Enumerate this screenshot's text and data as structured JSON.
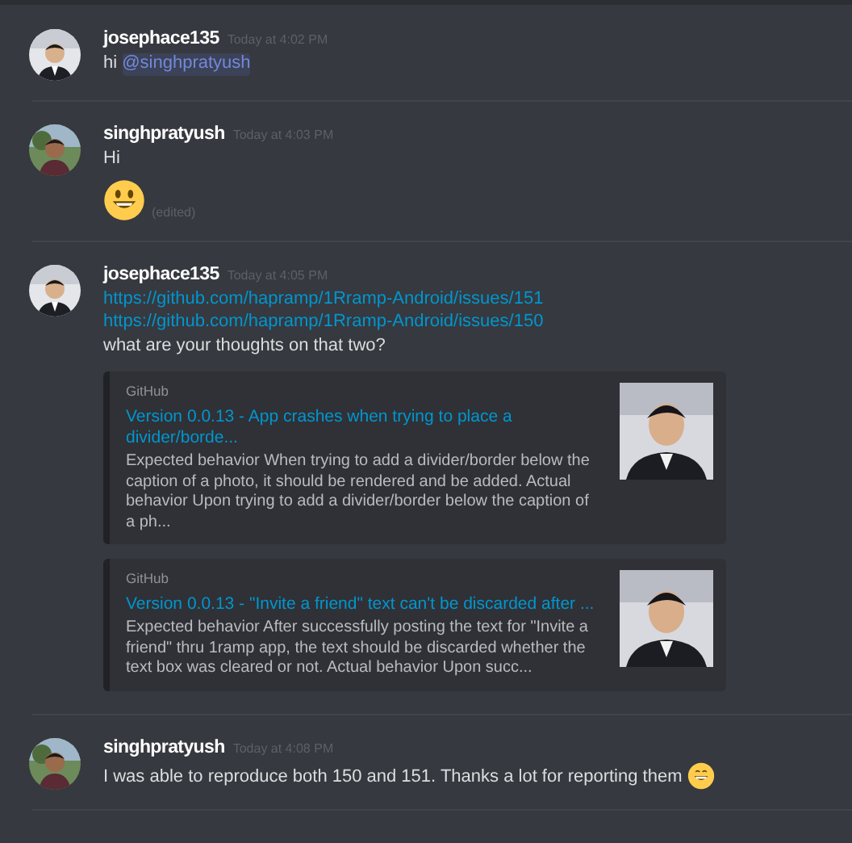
{
  "messages": [
    {
      "author": "josephace135",
      "timestamp": "Today at 4:02 PM",
      "lines": [
        [
          {
            "kind": "text",
            "text": "hi "
          },
          {
            "kind": "mention",
            "text": "@singhpratyush"
          }
        ]
      ]
    },
    {
      "author": "singhpratyush",
      "timestamp": "Today at 4:03 PM",
      "lines": [
        [
          {
            "kind": "text",
            "text": "Hi"
          }
        ],
        [
          {
            "kind": "emoji"
          },
          {
            "kind": "edited",
            "text": "(edited)"
          }
        ]
      ]
    },
    {
      "author": "josephace135",
      "timestamp": "Today at 4:05 PM",
      "lines": [
        [
          {
            "kind": "link",
            "text": "https://github.com/hapramp/1Rramp-Android/issues/151"
          }
        ],
        [
          {
            "kind": "link",
            "text": "https://github.com/hapramp/1Rramp-Android/issues/150"
          }
        ],
        [
          {
            "kind": "text",
            "text": "what are your thoughts on that two?"
          }
        ]
      ],
      "embeds": [
        {
          "provider": "GitHub",
          "title": "Version 0.0.13 -  App crashes when trying to place a divider/borde...",
          "description": "Expected behavior When trying to add a divider/border below the caption of a photo, it should be rendered and be added. Actual behavior Upon trying to add a divider/border below the caption of a ph..."
        },
        {
          "provider": "GitHub",
          "title": "Version 0.0.13 -  \"Invite a friend\" text can't be discarded after ...",
          "description": "Expected behavior After successfully posting the text for \"Invite a friend\" thru 1ramp app, the text should be discarded whether the text box was cleared or not. Actual behavior Upon succ..."
        }
      ]
    },
    {
      "author": "singhpratyush",
      "timestamp": "Today at 4:08 PM",
      "lines": [
        [
          {
            "kind": "text",
            "text": "I was able to reproduce both 150 and 151. Thanks a lot for reporting them "
          },
          {
            "kind": "grin"
          }
        ]
      ]
    }
  ]
}
